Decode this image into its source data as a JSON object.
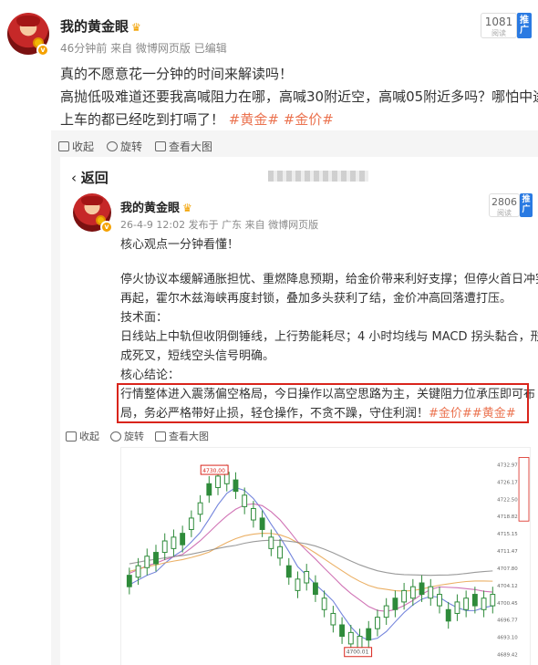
{
  "post": {
    "author": "我的黄金眼",
    "time": "46分钟前",
    "source": "来自 微博网页版 已编辑",
    "views_num": "1081",
    "views_label": "阅读",
    "promo": "推广",
    "text_line1": "真的不愿意花一分钟的时间来解读吗！",
    "text_line2": "高抛低吸难道还要我高喊阻力在哪，高喊30附近空，高喊05附近多吗？哪怕中途",
    "text_line3_pre": "上车的都已经吃到打嗝了！",
    "tag1": "#黄金#",
    "tag2": "#金价#"
  },
  "toolbar": {
    "collect": "收起",
    "rotate": "旋转",
    "view_large": "查看大图"
  },
  "inner": {
    "back": "返回",
    "author": "我的黄金眼",
    "time": "26-4-9 12:02",
    "source": "发布于 广东 来自 微博网页版",
    "views_num": "2806",
    "views_label": "阅读",
    "promo": "推广",
    "lines": [
      "核心观点一分钟看懂！",
      "",
      "停火协议本缓解通胀担忧、重燃降息预期，给金价带来利好支撑；但停火首日冲突",
      "再起，霍尔木兹海峡再度封锁，叠加多头获利了结，金价冲高回落遭打压。",
      "技术面：",
      "日线站上中轨但收阴倒锤线，上行势能耗尽；4 小时均线与 MACD 拐头黏合，形",
      "成死叉，短线空头信号明确。",
      "核心结论：",
      "行情整体进入震荡偏空格局，今日操作以高空思路为主，关键阻力位承压即可布"
    ],
    "last_line_pre": "局，务必严格带好止损，轻仓操作，不贪不躁，守住利润！",
    "last_tags": "#金价##黄金#",
    "toolbar_collect": "收起",
    "toolbar_rotate": "旋转",
    "toolbar_view": "查看大图"
  },
  "chart_data": {
    "type": "line",
    "title": "",
    "label_high": "4730.00",
    "label_low": "4700.01",
    "right_ticks": [
      "4732.97",
      "4726.17",
      "4722.50",
      "4718.82",
      "4715.15",
      "4711.47",
      "4707.80",
      "4704.12",
      "4700.45",
      "4696.77",
      "4693.10",
      "4689.42"
    ],
    "colors": {
      "up": "#2e8b3a",
      "down": "#2e8b3a",
      "ma_fast": "#5a6fd6",
      "ma_mid": "#c85aa8",
      "ma_slow": "#e8a24a",
      "ma_long": "#888888"
    }
  }
}
